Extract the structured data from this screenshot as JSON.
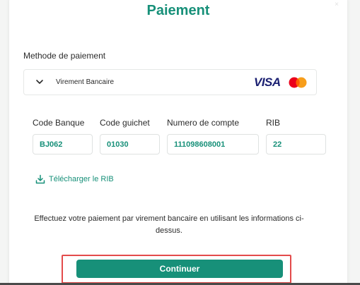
{
  "page": {
    "title": "Paiement",
    "close_glyph": "×"
  },
  "method": {
    "label": "Methode de paiement",
    "selected": "Virement Bancaire",
    "brands": {
      "visa": "VISA",
      "mastercard_icon": "mastercard-icon"
    }
  },
  "fields": [
    {
      "label": "Code Banque",
      "value": "BJ062"
    },
    {
      "label": "Code guichet",
      "value": "01030"
    },
    {
      "label": "Numero de compte",
      "value": "111098608001"
    },
    {
      "label": "RIB",
      "value": "22"
    }
  ],
  "download": {
    "label": "Télécharger le RIB",
    "icon": "download-icon"
  },
  "info": "Effectuez votre paiement par virement bancaire en utilisant les informations ci-dessus.",
  "continue_label": "Continuer",
  "colors": {
    "accent": "#179079",
    "highlight": "#e34b4b",
    "text": "#2b2b2b"
  }
}
